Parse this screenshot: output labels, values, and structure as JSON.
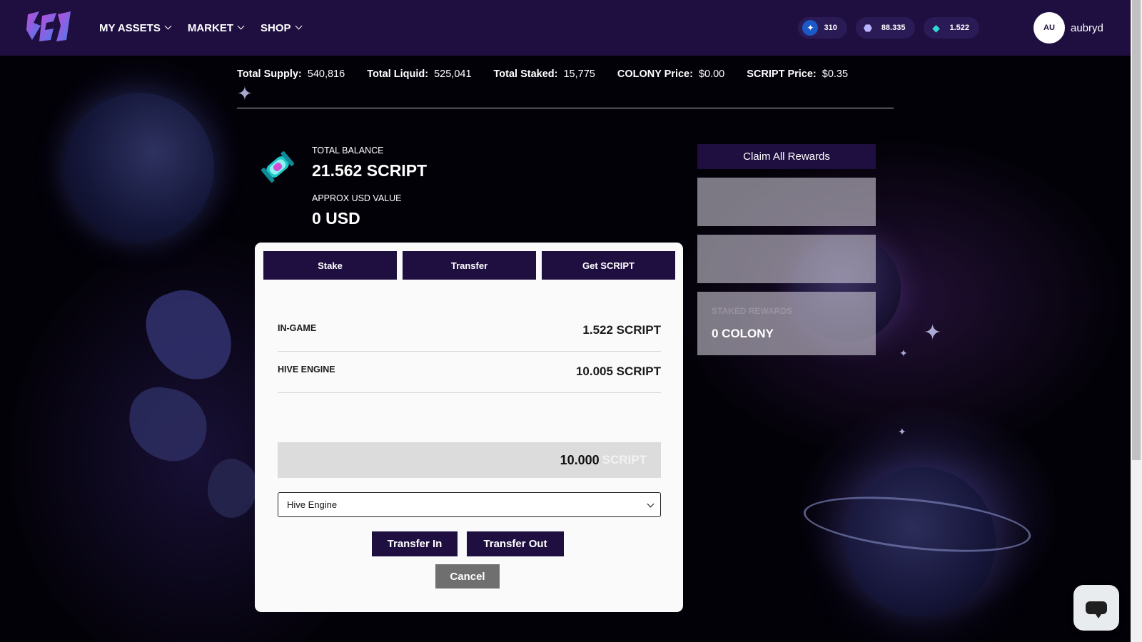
{
  "nav": {
    "items": [
      {
        "label": "MY ASSETS",
        "icon": "chevron-down-icon"
      },
      {
        "label": "MARKET",
        "icon": "chevron-down-icon"
      },
      {
        "label": "SHOP",
        "icon": "chevron-down-icon"
      }
    ]
  },
  "wallet_pills": [
    {
      "icon": "star-token-icon",
      "value": "310"
    },
    {
      "icon": "colony-token-icon",
      "value": "88.335"
    },
    {
      "icon": "script-token-icon",
      "value": "1.522"
    }
  ],
  "user": {
    "initials": "AU",
    "name": "aubryd"
  },
  "stats": {
    "total_supply_label": "Total Supply:",
    "total_supply": "540,816",
    "total_liquid_label": "Total Liquid:",
    "total_liquid": "525,041",
    "total_staked_label": "Total Staked:",
    "total_staked": "15,775",
    "colony_price_label": "COLONY Price:",
    "colony_price": "$0.00",
    "script_price_label": "SCRIPT Price:",
    "script_price": "$0.35"
  },
  "balance": {
    "total_label": "TOTAL BALANCE",
    "total_value": "21.562 SCRIPT",
    "usd_label": "APPROX USD VALUE",
    "usd_value": "0 USD"
  },
  "modal": {
    "tabs": [
      "Stake",
      "Transfer",
      "Get SCRIPT"
    ],
    "rows": [
      {
        "label": "IN-GAME",
        "value": "1.522 SCRIPT"
      },
      {
        "label": "HIVE ENGINE",
        "value": "10.005 SCRIPT"
      }
    ],
    "amount": {
      "value": "10.000",
      "unit": "SCRIPT"
    },
    "destination": {
      "selected": "Hive Engine"
    },
    "transfer_in_label": "Transfer In",
    "transfer_out_label": "Transfer Out",
    "cancel_label": "Cancel"
  },
  "rewards": {
    "claim_label": "Claim All Rewards",
    "cards": [
      {
        "faint_label": "",
        "value": ""
      },
      {
        "faint_label": "",
        "value": ""
      },
      {
        "faint_label": "STAKED REWARDS",
        "value": "0 COLONY"
      }
    ]
  },
  "colors": {
    "brand_dark": "#1f0f40",
    "modal_bg": "#fafafa",
    "cancel_gray": "#6f6f6f"
  }
}
